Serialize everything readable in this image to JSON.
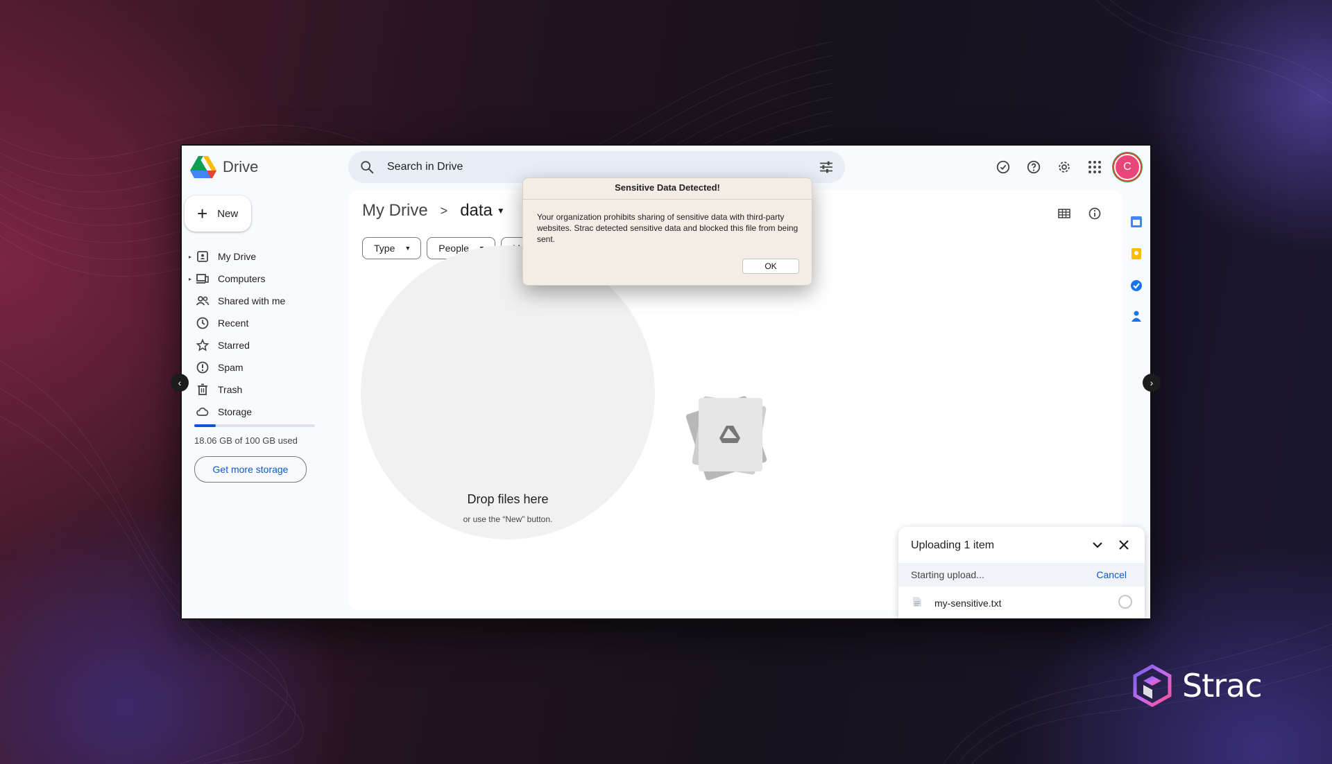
{
  "app": {
    "name": "Drive"
  },
  "search": {
    "placeholder": "Search in Drive"
  },
  "user": {
    "avatar_letter": "C"
  },
  "sidebar": {
    "new_label": "New",
    "items": [
      {
        "label": "My Drive",
        "icon": "my-drive-icon",
        "expandable": true
      },
      {
        "label": "Computers",
        "icon": "computers-icon",
        "expandable": true
      },
      {
        "label": "Shared with me",
        "icon": "shared-icon",
        "expandable": false
      },
      {
        "label": "Recent",
        "icon": "clock-icon",
        "expandable": false
      },
      {
        "label": "Starred",
        "icon": "star-icon",
        "expandable": false
      },
      {
        "label": "Spam",
        "icon": "spam-icon",
        "expandable": false
      },
      {
        "label": "Trash",
        "icon": "trash-icon",
        "expandable": false
      },
      {
        "label": "Storage",
        "icon": "cloud-icon",
        "expandable": false
      }
    ],
    "storage_used_fraction": 0.1806,
    "storage_text": "18.06 GB of 100 GB used",
    "get_more_storage": "Get more storage"
  },
  "breadcrumb": {
    "root": "My Drive",
    "current": "data"
  },
  "filters": [
    "Type",
    "People",
    "Mo"
  ],
  "dropzone": {
    "title": "Drop files here",
    "subtitle": "or use the “New” button."
  },
  "upload_panel": {
    "title": "Uploading 1 item",
    "status": "Starting upload...",
    "cancel_label": "Cancel",
    "file_name": "my-sensitive.txt"
  },
  "modal": {
    "title": "Sensitive Data Detected!",
    "message": "Your organization prohibits sharing of sensitive data with third-party websites. Strac detected sensitive data and blocked this file from being sent.",
    "ok_label": "OK"
  },
  "brand": {
    "name": "Strac"
  },
  "colors": {
    "accent": "#0b57d0",
    "avatar": "#e8467a",
    "modal_bg": "#f3ede6"
  }
}
